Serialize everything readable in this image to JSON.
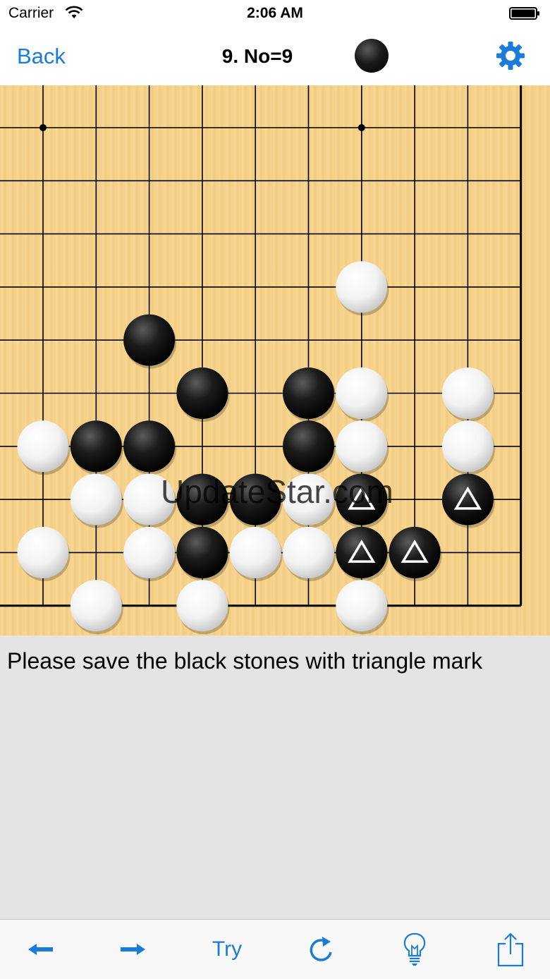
{
  "status_bar": {
    "carrier": "Carrier",
    "time": "2:06 AM"
  },
  "nav": {
    "back_label": "Back",
    "title": "9. No=9",
    "to_play": "black",
    "settings_icon": "gear-icon"
  },
  "board": {
    "size": "19x19",
    "view": "lower-right corner",
    "watermark": "UpdateStar.com",
    "stones": [
      {
        "color": "white",
        "col": 6,
        "row": 3,
        "mark": ""
      },
      {
        "color": "black",
        "col": 2,
        "row": 4,
        "mark": ""
      },
      {
        "color": "black",
        "col": 3,
        "row": 5,
        "mark": ""
      },
      {
        "color": "black",
        "col": 5,
        "row": 5,
        "mark": ""
      },
      {
        "color": "white",
        "col": 6,
        "row": 5,
        "mark": ""
      },
      {
        "color": "white",
        "col": 8,
        "row": 5,
        "mark": ""
      },
      {
        "color": "white",
        "col": 0,
        "row": 6,
        "mark": ""
      },
      {
        "color": "black",
        "col": 1,
        "row": 6,
        "mark": ""
      },
      {
        "color": "black",
        "col": 2,
        "row": 6,
        "mark": ""
      },
      {
        "color": "black",
        "col": 5,
        "row": 6,
        "mark": ""
      },
      {
        "color": "white",
        "col": 6,
        "row": 6,
        "mark": ""
      },
      {
        "color": "white",
        "col": 8,
        "row": 6,
        "mark": ""
      },
      {
        "color": "white",
        "col": 1,
        "row": 7,
        "mark": ""
      },
      {
        "color": "white",
        "col": 2,
        "row": 7,
        "mark": ""
      },
      {
        "color": "black",
        "col": 3,
        "row": 7,
        "mark": ""
      },
      {
        "color": "black",
        "col": 4,
        "row": 7,
        "mark": ""
      },
      {
        "color": "white",
        "col": 5,
        "row": 7,
        "mark": ""
      },
      {
        "color": "black",
        "col": 6,
        "row": 7,
        "mark": "triangle"
      },
      {
        "color": "black",
        "col": 8,
        "row": 7,
        "mark": "triangle"
      },
      {
        "color": "white",
        "col": 0,
        "row": 8,
        "mark": ""
      },
      {
        "color": "white",
        "col": 2,
        "row": 8,
        "mark": ""
      },
      {
        "color": "black",
        "col": 3,
        "row": 8,
        "mark": ""
      },
      {
        "color": "white",
        "col": 4,
        "row": 8,
        "mark": ""
      },
      {
        "color": "white",
        "col": 5,
        "row": 8,
        "mark": ""
      },
      {
        "color": "black",
        "col": 6,
        "row": 8,
        "mark": "triangle"
      },
      {
        "color": "black",
        "col": 7,
        "row": 8,
        "mark": "triangle"
      },
      {
        "color": "white",
        "col": 1,
        "row": 9,
        "mark": ""
      },
      {
        "color": "white",
        "col": 3,
        "row": 9,
        "mark": ""
      },
      {
        "color": "white",
        "col": 6,
        "row": 9,
        "mark": ""
      }
    ],
    "star_points": [
      {
        "col": 0,
        "row": 0
      },
      {
        "col": 6,
        "row": 0
      }
    ]
  },
  "problem_text": "Please save the black stones with triangle mark",
  "toolbar": {
    "prev_icon": "arrow-left-icon",
    "next_icon": "arrow-right-icon",
    "try_label": "Try",
    "reset_icon": "refresh-icon",
    "hint_icon": "lightbulb-icon",
    "share_icon": "share-icon"
  },
  "colors": {
    "accent": "#1a7bdb",
    "board": "#f4cf86",
    "panel": "#e4e4e4"
  }
}
